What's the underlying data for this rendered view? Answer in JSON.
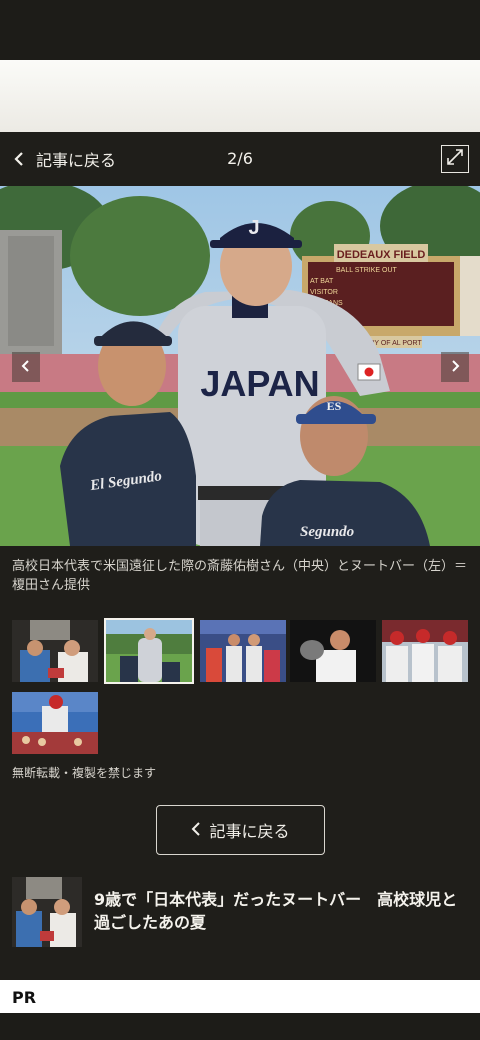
{
  "viewer": {
    "back_label": "記事に戻る",
    "counter": "2/6"
  },
  "photo": {
    "jersey_center": "JAPAN",
    "jersey_left": "El Segundo",
    "jersey_right": "Segundo",
    "cap_center": "J",
    "cap_right": "ES",
    "scoreboard_title": "DEDEAUX FIELD",
    "scoreboard_row1": "BALL   STRIKE   OUT",
    "scoreboard_row2": "AT BAT",
    "scoreboard_row3": "VISITOR",
    "scoreboard_row4": "TROJANS",
    "scoreboard_footer": "ORY OF AL PORT"
  },
  "caption": "高校日本代表で米国遠征した際の斎藤佑樹さん（中央）とヌートバー（左）＝榎田さん提供",
  "copyright": "無断転載・複製を禁じます",
  "back_button_label": "記事に戻る",
  "related": {
    "title": "9歳で「日本代表」だったヌートバー　高校球児と過ごしたあの夏"
  },
  "pr_label": "PR",
  "colors": {
    "background": "#1f1e1a",
    "accent_white": "#f4f2ec"
  }
}
